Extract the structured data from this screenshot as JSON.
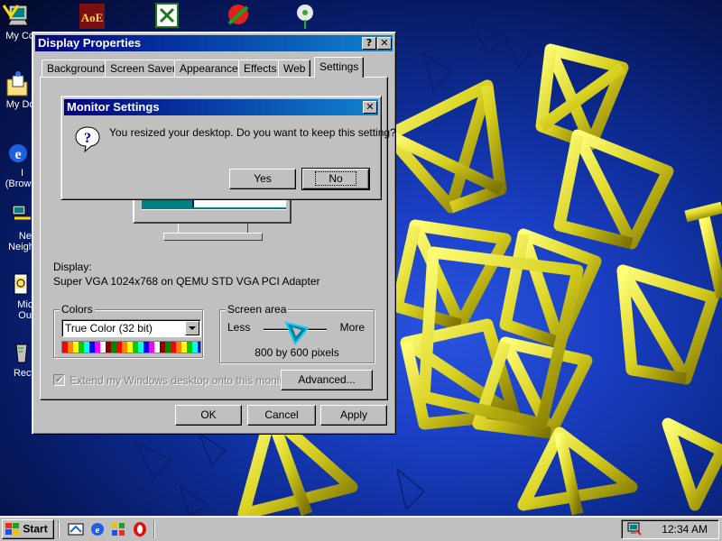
{
  "desktop": {
    "icons": [
      {
        "label": "My Co",
        "icon": "my-computer-icon"
      },
      {
        "label": "My Doc",
        "icon": "my-documents-icon"
      },
      {
        "label": "I",
        "label2": "(Brows",
        "icon": "internet-explorer-icon"
      },
      {
        "label": "Net",
        "label2": "Neighb",
        "icon": "network-neighborhood-icon"
      },
      {
        "label": "Micr",
        "label2": "Out",
        "icon": "outlook-icon"
      },
      {
        "label": "Recy",
        "icon": "recycle-bin-icon"
      }
    ],
    "top_icons": [
      {
        "text": "AoE",
        "icon": "age-of-empires-icon"
      },
      {
        "icon": "excel-icon"
      },
      {
        "icon": "shortcut-app-icon"
      },
      {
        "icon": "flower-app-icon"
      }
    ]
  },
  "display_properties": {
    "title": "Display Properties",
    "help_btn": "?",
    "close_btn": "✕",
    "tabs": [
      "Background",
      "Screen Saver",
      "Appearance",
      "Effects",
      "Web",
      "Settings"
    ],
    "active_tab": "Settings",
    "display_label": "Display:",
    "display_value": "Super VGA 1024x768 on QEMU STD VGA PCI Adapter",
    "colors_group": "Colors",
    "colors_value": "True Color (32 bit)",
    "screen_area_group": "Screen area",
    "less_label": "Less",
    "more_label": "More",
    "resolution_text": "800 by 600 pixels",
    "resolution_fraction": 0.5,
    "extend_checkbox": "Extend my Windows desktop onto this monitor.",
    "advanced_btn": "Advanced...",
    "ok_btn": "OK",
    "cancel_btn": "Cancel",
    "apply_btn": "Apply"
  },
  "monitor_settings": {
    "title": "Monitor Settings",
    "close_btn": "✕",
    "message": "You resized your desktop.  Do you want to keep this setting?",
    "yes_btn": "Yes",
    "no_btn": "No"
  },
  "taskbar": {
    "start": "Start",
    "quicklaunch": [
      "show-desktop-icon",
      "internet-explorer-icon",
      "channels-icon",
      "opera-icon"
    ],
    "clock": "12:34 AM"
  }
}
